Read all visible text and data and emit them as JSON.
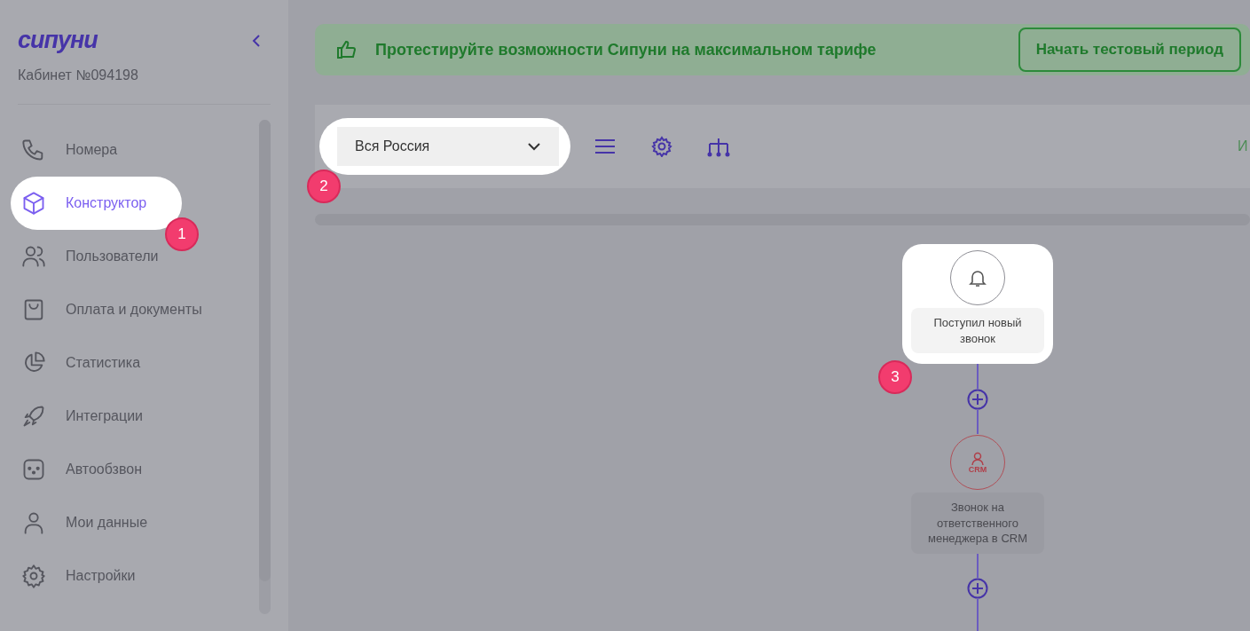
{
  "sidebar": {
    "logo": "сипуни",
    "account": "Кабинет №094198",
    "items": [
      {
        "label": "Номера",
        "selected": false
      },
      {
        "label": "Конструктор",
        "selected": true
      },
      {
        "label": "Пользователи",
        "selected": false
      },
      {
        "label": "Оплата и документы",
        "selected": false
      },
      {
        "label": "Статистика",
        "selected": false
      },
      {
        "label": "Интеграции",
        "selected": false
      },
      {
        "label": "Автообзвон",
        "selected": false
      },
      {
        "label": "Мои данные",
        "selected": false
      },
      {
        "label": "Настройки",
        "selected": false
      }
    ]
  },
  "banner": {
    "text": "Протестируйте возможности Сипуни на максимальном тарифе",
    "button": "Начать тестовый период"
  },
  "toolbar": {
    "region": "Вся Россия",
    "cut_text": "И"
  },
  "flow": [
    {
      "kind": "trigger",
      "label": "Поступил новый звонок",
      "highlighted": true
    },
    {
      "kind": "crm",
      "label": "Звонок на ответственного менеджера в CRM",
      "badge": "CRM",
      "highlighted": false
    }
  ],
  "tour_steps": [
    "1",
    "2",
    "3"
  ]
}
